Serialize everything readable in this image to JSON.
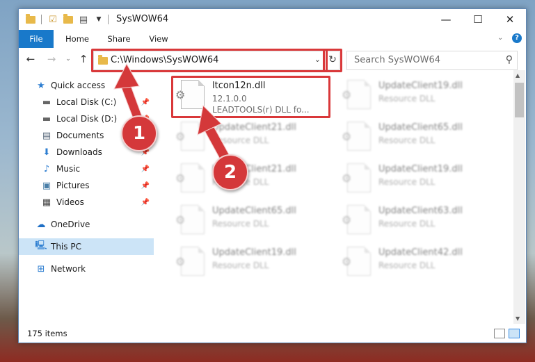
{
  "window": {
    "title": "SysWOW64"
  },
  "ribbon": {
    "tabs": [
      "File",
      "Home",
      "Share",
      "View"
    ]
  },
  "address": {
    "path": "C:\\Windows\\SysWOW64"
  },
  "search": {
    "placeholder": "Search SysWOW64"
  },
  "nav": {
    "items": [
      {
        "label": "Quick access",
        "icon": "star-icon"
      },
      {
        "label": "Local Disk (C:)",
        "icon": "drive-icon"
      },
      {
        "label": "Local Disk (D:)",
        "icon": "drive-icon"
      },
      {
        "label": "Documents",
        "icon": "documents-icon"
      },
      {
        "label": "Downloads",
        "icon": "download-icon"
      },
      {
        "label": "Music",
        "icon": "music-icon"
      },
      {
        "label": "Pictures",
        "icon": "pictures-icon"
      },
      {
        "label": "Videos",
        "icon": "videos-icon"
      },
      {
        "label": "OneDrive",
        "icon": "cloud-icon"
      },
      {
        "label": "This PC",
        "icon": "computer-icon"
      },
      {
        "label": "Network",
        "icon": "network-icon"
      }
    ]
  },
  "files": [
    {
      "name": "ltcon12n.dll",
      "line1": "12.1.0.0",
      "line2": "LEADTOOLS(r) DLL fo..."
    },
    {
      "name": "UpdateClient19.dll",
      "line1": "Resource DLL"
    },
    {
      "name": "UpdateClient21.dll",
      "line1": "Resource DLL"
    },
    {
      "name": "UpdateClient65.dll",
      "line1": "Resource DLL"
    },
    {
      "name": "UpdateClient21.dll",
      "line1": "Resource DLL"
    },
    {
      "name": "UpdateClient19.dll",
      "line1": "Resource DLL"
    },
    {
      "name": "UpdateClient65.dll",
      "line1": "Resource DLL"
    },
    {
      "name": "UpdateClient63.dll",
      "line1": "Resource DLL"
    },
    {
      "name": "UpdateClient19.dll",
      "line1": "Resource DLL"
    },
    {
      "name": "UpdateClient42.dll",
      "line1": "Resource DLL"
    }
  ],
  "status": {
    "count": "175 items"
  },
  "callouts": [
    "1",
    "2"
  ],
  "colors": {
    "accent": "#1979ca",
    "highlight": "#d9383a",
    "selection": "#cce4f7"
  }
}
